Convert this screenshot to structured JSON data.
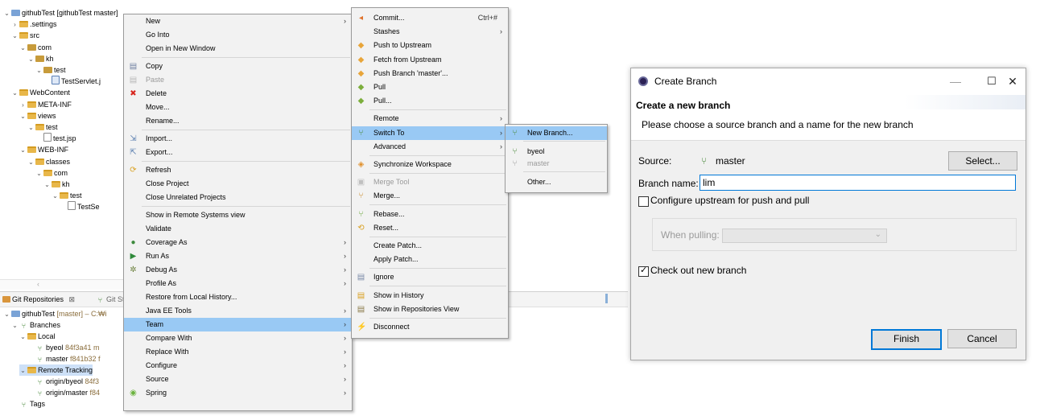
{
  "explorer": {
    "rows": [
      {
        "label": "githubTest [githubTest master]",
        "indent": 0,
        "tw": "⌄",
        "icon": "proj",
        "name": "tree-project-githubtest",
        "suffix": ""
      },
      {
        "label": ".settings",
        "indent": 1,
        "tw": "›",
        "icon": "folder",
        "name": "tree-folder-settings",
        "suffix": ""
      },
      {
        "label": "src",
        "indent": 1,
        "tw": "⌄",
        "icon": "folder",
        "name": "tree-folder-src",
        "suffix": ""
      },
      {
        "label": "com",
        "indent": 2,
        "tw": "⌄",
        "icon": "pkg",
        "name": "tree-folder-com",
        "suffix": ""
      },
      {
        "label": "kh",
        "indent": 3,
        "tw": "⌄",
        "icon": "pkg",
        "name": "tree-folder-kh",
        "suffix": ""
      },
      {
        "label": "test",
        "indent": 4,
        "tw": "⌄",
        "icon": "pkg",
        "name": "tree-folder-test",
        "suffix": ""
      },
      {
        "label": "TestServlet.j",
        "indent": 5,
        "tw": "",
        "icon": "java",
        "name": "tree-file-testservlet",
        "suffix": ""
      },
      {
        "label": "WebContent",
        "indent": 1,
        "tw": "⌄",
        "icon": "folder",
        "name": "tree-folder-webcontent",
        "suffix": ""
      },
      {
        "label": "META-INF",
        "indent": 2,
        "tw": "›",
        "icon": "folder",
        "name": "tree-folder-meta-inf",
        "suffix": ""
      },
      {
        "label": "views",
        "indent": 2,
        "tw": "⌄",
        "icon": "folder",
        "name": "tree-folder-views",
        "suffix": ""
      },
      {
        "label": "test",
        "indent": 3,
        "tw": "⌄",
        "icon": "folder",
        "name": "tree-folder-views-test",
        "suffix": ""
      },
      {
        "label": "test.jsp",
        "indent": 4,
        "tw": "",
        "icon": "file",
        "name": "tree-file-test-jsp",
        "suffix": ""
      },
      {
        "label": "WEB-INF",
        "indent": 2,
        "tw": "⌄",
        "icon": "folder",
        "name": "tree-folder-web-inf",
        "suffix": ""
      },
      {
        "label": "classes",
        "indent": 3,
        "tw": "⌄",
        "icon": "folder",
        "name": "tree-folder-classes",
        "suffix": ""
      },
      {
        "label": "com",
        "indent": 4,
        "tw": "⌄",
        "icon": "folder",
        "name": "tree-folder-classes-com",
        "suffix": ""
      },
      {
        "label": "kh",
        "indent": 5,
        "tw": "⌄",
        "icon": "folder",
        "name": "tree-folder-classes-kh",
        "suffix": ""
      },
      {
        "label": "test",
        "indent": 6,
        "tw": "⌄",
        "icon": "folder",
        "name": "tree-folder-classes-test",
        "suffix": ""
      },
      {
        "label": "TestSe",
        "indent": 7,
        "tw": "",
        "icon": "file",
        "name": "tree-file-testse",
        "suffix": ""
      }
    ]
  },
  "git_panel": {
    "tab_repositories": "Git Repositories",
    "tab_close": "⊠",
    "tab_staging": "Git St",
    "rows": [
      {
        "label": "githubTest",
        "suffix": " [master] – C:₩i",
        "indent": 0,
        "tw": "⌄",
        "icon": "proj",
        "name": "git-repo-githubtest"
      },
      {
        "label": "Branches",
        "suffix": "",
        "indent": 1,
        "tw": "⌄",
        "icon": "branch",
        "name": "git-branches-node"
      },
      {
        "label": "Local",
        "suffix": "",
        "indent": 2,
        "tw": "⌄",
        "icon": "folder",
        "name": "git-local-node"
      },
      {
        "label": "byeol",
        "suffix": " 84f3a41 m",
        "indent": 3,
        "tw": "",
        "icon": "branch",
        "name": "git-branch-byeol"
      },
      {
        "label": "master",
        "suffix": " f841b32 f",
        "indent": 3,
        "tw": "",
        "icon": "branch",
        "name": "git-branch-master"
      },
      {
        "label": "Remote Tracking",
        "suffix": "",
        "indent": 2,
        "tw": "⌄",
        "icon": "folder",
        "name": "git-remote-tracking-node"
      },
      {
        "label": "origin/byeol",
        "suffix": " 84f3",
        "indent": 3,
        "tw": "",
        "icon": "branch",
        "name": "git-origin-byeol"
      },
      {
        "label": "origin/master",
        "suffix": " f84",
        "indent": 3,
        "tw": "",
        "icon": "branch",
        "name": "git-origin-master"
      },
      {
        "label": "Tags",
        "suffix": "",
        "indent": 1,
        "tw": "",
        "icon": "branch",
        "name": "git-tags-node"
      }
    ]
  },
  "context_menu": {
    "items": [
      {
        "label": "New",
        "arrow": true,
        "icon": "",
        "name": "menu-new"
      },
      {
        "label": "Go Into",
        "arrow": false,
        "icon": "",
        "name": "menu-go-into"
      },
      {
        "label": "Open in New Window",
        "arrow": false,
        "icon": "",
        "name": "menu-open-new-window"
      },
      {
        "sep": true
      },
      {
        "label": "Copy",
        "arrow": false,
        "icon": "▤",
        "name": "menu-copy",
        "icolor": "#6f7fa0"
      },
      {
        "label": "Paste",
        "arrow": false,
        "icon": "▤",
        "name": "menu-paste",
        "disabled": true,
        "icolor": "#b8b8b8"
      },
      {
        "label": "Delete",
        "arrow": false,
        "icon": "✖",
        "name": "menu-delete",
        "icolor": "#d7261e"
      },
      {
        "label": "Move...",
        "arrow": false,
        "icon": "",
        "name": "menu-move"
      },
      {
        "label": "Rename...",
        "arrow": false,
        "icon": "",
        "name": "menu-rename"
      },
      {
        "sep": true
      },
      {
        "label": "Import...",
        "arrow": false,
        "icon": "⇲",
        "name": "menu-import",
        "icolor": "#5b7fb0"
      },
      {
        "label": "Export...",
        "arrow": false,
        "icon": "⇱",
        "name": "menu-export",
        "icolor": "#5b7fb0"
      },
      {
        "sep": true
      },
      {
        "label": "Refresh",
        "arrow": false,
        "icon": "⟳",
        "name": "menu-refresh",
        "icolor": "#d9a021"
      },
      {
        "label": "Close Project",
        "arrow": false,
        "icon": "",
        "name": "menu-close-project"
      },
      {
        "label": "Close Unrelated Projects",
        "arrow": false,
        "icon": "",
        "name": "menu-close-unrelated"
      },
      {
        "sep": true
      },
      {
        "label": "Show in Remote Systems view",
        "arrow": false,
        "icon": "",
        "name": "menu-show-remote-systems"
      },
      {
        "label": "Validate",
        "arrow": false,
        "icon": "",
        "name": "menu-validate"
      },
      {
        "label": "Coverage As",
        "arrow": true,
        "icon": "●",
        "name": "menu-coverage-as",
        "icolor": "#3d8a3d"
      },
      {
        "label": "Run As",
        "arrow": true,
        "icon": "▶",
        "name": "menu-run-as",
        "icolor": "#2f8a3a"
      },
      {
        "label": "Debug As",
        "arrow": true,
        "icon": "✲",
        "name": "menu-debug-as",
        "icolor": "#6a7f3a"
      },
      {
        "label": "Profile As",
        "arrow": true,
        "icon": "",
        "name": "menu-profile-as"
      },
      {
        "label": "Restore from Local History...",
        "arrow": false,
        "icon": "",
        "name": "menu-restore-history"
      },
      {
        "label": "Java EE Tools",
        "arrow": true,
        "icon": "",
        "name": "menu-java-ee-tools"
      },
      {
        "label": "Team",
        "arrow": true,
        "icon": "",
        "name": "menu-team",
        "hl": true
      },
      {
        "label": "Compare With",
        "arrow": true,
        "icon": "",
        "name": "menu-compare-with"
      },
      {
        "label": "Replace With",
        "arrow": true,
        "icon": "",
        "name": "menu-replace-with"
      },
      {
        "label": "Configure",
        "arrow": true,
        "icon": "",
        "name": "menu-configure"
      },
      {
        "label": "Source",
        "arrow": true,
        "icon": "",
        "name": "menu-source"
      },
      {
        "label": "Spring",
        "arrow": true,
        "icon": "◉",
        "name": "menu-spring",
        "icolor": "#6cb33f"
      }
    ]
  },
  "team_menu": {
    "items": [
      {
        "label": "Commit...",
        "accel": "Ctrl+#",
        "arrow": false,
        "icon": "◂",
        "name": "team-commit",
        "icolor": "#e0732c"
      },
      {
        "label": "Stashes",
        "arrow": true,
        "icon": "",
        "name": "team-stashes"
      },
      {
        "label": "Push to Upstream",
        "arrow": false,
        "icon": "◆",
        "name": "team-push-upstream",
        "icolor": "#e8a53a"
      },
      {
        "label": "Fetch from Upstream",
        "arrow": false,
        "icon": "◆",
        "name": "team-fetch-upstream",
        "icolor": "#e8a53a"
      },
      {
        "label": "Push Branch 'master'...",
        "arrow": false,
        "icon": "◆",
        "name": "team-push-branch",
        "icolor": "#e8a53a"
      },
      {
        "label": "Pull",
        "arrow": false,
        "icon": "◆",
        "name": "team-pull",
        "icolor": "#7cae3c"
      },
      {
        "label": "Pull...",
        "arrow": false,
        "icon": "◆",
        "name": "team-pull-dots",
        "icolor": "#7cae3c"
      },
      {
        "sep": true
      },
      {
        "label": "Remote",
        "arrow": true,
        "icon": "",
        "name": "team-remote"
      },
      {
        "label": "Switch To",
        "arrow": true,
        "icon": "⑂",
        "name": "team-switch-to",
        "hl": true,
        "icolor": "#4a8a3c"
      },
      {
        "label": "Advanced",
        "arrow": true,
        "icon": "",
        "name": "team-advanced"
      },
      {
        "sep": true
      },
      {
        "label": "Synchronize Workspace",
        "arrow": false,
        "icon": "◈",
        "name": "team-synchronize",
        "icolor": "#e0902c"
      },
      {
        "sep": true
      },
      {
        "label": "Merge Tool",
        "arrow": false,
        "icon": "▣",
        "name": "team-merge-tool",
        "disabled": true,
        "icolor": "#c0c0c0"
      },
      {
        "label": "Merge...",
        "arrow": false,
        "icon": "⑂",
        "name": "team-merge",
        "icolor": "#c98a2a"
      },
      {
        "sep": true
      },
      {
        "label": "Rebase...",
        "arrow": false,
        "icon": "⑂",
        "name": "team-rebase",
        "icolor": "#6aa83a"
      },
      {
        "label": "Reset...",
        "arrow": false,
        "icon": "⟲",
        "name": "team-reset",
        "icolor": "#d9a021"
      },
      {
        "sep": true
      },
      {
        "label": "Create Patch...",
        "arrow": false,
        "icon": "",
        "name": "team-create-patch"
      },
      {
        "label": "Apply Patch...",
        "arrow": false,
        "icon": "",
        "name": "team-apply-patch"
      },
      {
        "sep": true
      },
      {
        "label": "Ignore",
        "arrow": false,
        "icon": "▤",
        "name": "team-ignore",
        "icolor": "#7a8aa8"
      },
      {
        "sep": true
      },
      {
        "label": "Show in History",
        "arrow": false,
        "icon": "▤",
        "name": "team-show-history",
        "icolor": "#d9a021"
      },
      {
        "label": "Show in Repositories View",
        "arrow": false,
        "icon": "▤",
        "name": "team-show-repositories",
        "icolor": "#8a7a4a"
      },
      {
        "sep": true
      },
      {
        "label": "Disconnect",
        "arrow": false,
        "icon": "⚡",
        "name": "team-disconnect",
        "icolor": "#c0392b"
      }
    ]
  },
  "switch_menu": {
    "items": [
      {
        "label": "New Branch...",
        "icon": "⑂",
        "name": "switch-new-branch",
        "hl": true,
        "icolor": "#4a8a3c"
      },
      {
        "sep": true
      },
      {
        "label": "byeol",
        "icon": "⑂",
        "name": "switch-byeol",
        "icolor": "#4a8a3c"
      },
      {
        "label": "master",
        "icon": "⑂",
        "name": "switch-master",
        "disabled": true,
        "icolor": "#a0a0a0"
      },
      {
        "sep": true
      },
      {
        "label": "Other...",
        "icon": "",
        "name": "switch-other"
      }
    ]
  },
  "dialog": {
    "title": "Create Branch",
    "minimize": "—",
    "maximize": "☐",
    "close": "✕",
    "header_title": "Create a new branch",
    "header_desc": "Please choose a source branch and a name for the new branch",
    "source_label": "Source:",
    "source_value": "master",
    "select_button": "Select...",
    "branch_name_label": "Branch name:",
    "branch_name_value": "lim",
    "configure_upstream_label": "Configure upstream for push and pull",
    "configure_upstream_checked": false,
    "when_pulling_label": "When pulling:",
    "when_pulling_value": "",
    "checkout_label": "Check out new branch",
    "checkout_checked": true,
    "finish_button": "Finish",
    "cancel_button": "Cancel",
    "accent_color": "#0078d7"
  }
}
